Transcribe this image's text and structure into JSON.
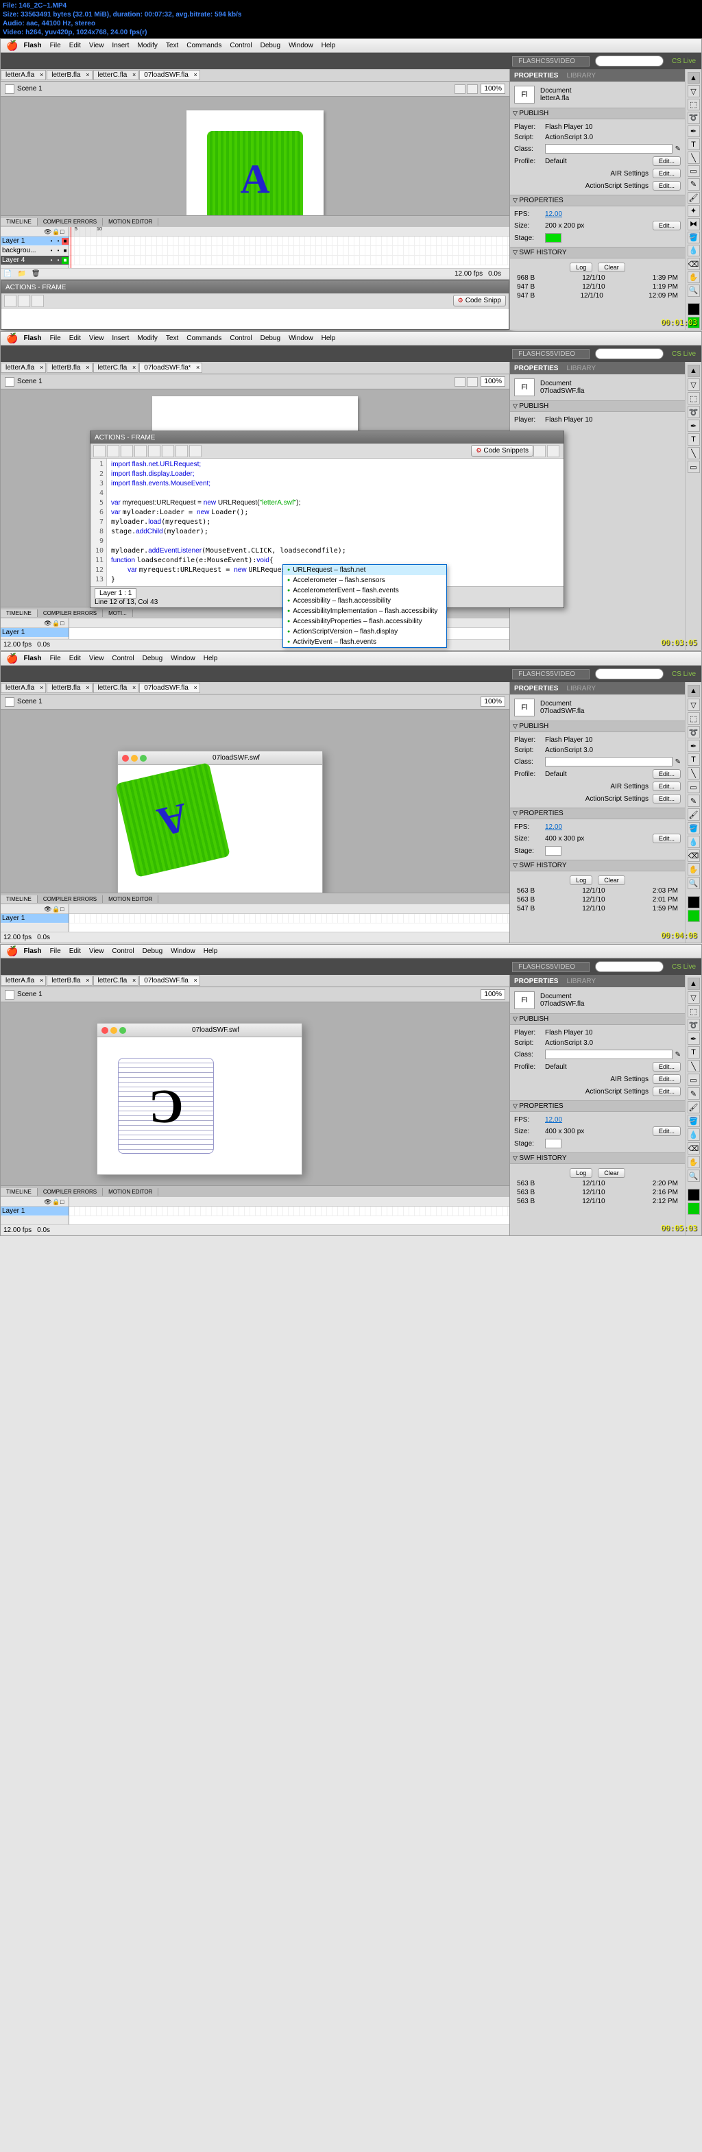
{
  "info": {
    "file": "File: 146_2C~1.MP4",
    "size": "Size: 33563491 bytes (32.01 MiB), duration: 00:07:32, avg.bitrate: 594 kb/s",
    "audio": "Audio: aac, 44100 Hz, stereo",
    "video": "Video: h264, yuv420p, 1024x768, 24.00 fps(r)"
  },
  "menu": {
    "app": "Flash",
    "items": [
      "File",
      "Edit",
      "View",
      "Insert",
      "Modify",
      "Text",
      "Commands",
      "Control",
      "Debug",
      "Window",
      "Help"
    ],
    "items_swf": [
      "File",
      "Edit",
      "View",
      "Control",
      "Debug",
      "Window",
      "Help"
    ]
  },
  "workspace_name": "FLASHCS5VIDEO",
  "cslive": "CS Live",
  "tabs": [
    "letterA.fla",
    "letterB.fla",
    "letterC.fla",
    "07loadSWF.fla"
  ],
  "scene": "Scene 1",
  "zoom": "100%",
  "timeline": {
    "tabs": [
      "TIMELINE",
      "COMPILER ERRORS",
      "MOTION EDITOR"
    ],
    "layers_s1": [
      "Layer 1",
      "backgrou...",
      "Layer 4"
    ],
    "layers_s2": [
      "Layer 1"
    ],
    "footer_fps": "12.00 fps",
    "footer_time": "0.0s"
  },
  "props": {
    "tabs": [
      "PROPERTIES",
      "LIBRARY"
    ],
    "doc_label": "Document",
    "doc_icon": "Fl",
    "publish": "PUBLISH",
    "properties": "PROPERTIES",
    "swf_history": "SWF HISTORY",
    "player_label": "Player:",
    "script_label": "Script:",
    "class_label": "Class:",
    "profile_label": "Profile:",
    "fps_label": "FPS:",
    "size_label": "Size:",
    "stage_label": "Stage:",
    "player": "Flash Player 10",
    "script": "ActionScript 3.0",
    "profile": "Default",
    "air_label": "AIR Settings",
    "as_label": "ActionScript Settings",
    "edit_btn": "Edit...",
    "log_btn": "Log",
    "clear_btn": "Clear",
    "s1": {
      "doc_name": "letterA.fla",
      "fps": "12.00",
      "size": "200 x 200 px",
      "history": [
        {
          "size": "968 B",
          "date": "12/1/10",
          "time": "1:39 PM"
        },
        {
          "size": "947 B",
          "date": "12/1/10",
          "time": "1:19 PM"
        },
        {
          "size": "947 B",
          "date": "12/1/10",
          "time": "12:09 PM"
        }
      ]
    },
    "s2": {
      "doc_name": "07loadSWF.fla",
      "fps": "12.00",
      "size": "400 x 300 px",
      "history": [
        {
          "size": "563 B",
          "date": "12/1/10",
          "time": "2:03 PM"
        },
        {
          "size": "563 B",
          "date": "12/1/10",
          "time": "2:01 PM"
        },
        {
          "size": "547 B",
          "date": "12/1/10",
          "time": "1:59 PM"
        }
      ]
    },
    "s4": {
      "history": [
        {
          "size": "563 B",
          "date": "12/1/10",
          "time": "2:20 PM"
        },
        {
          "size": "563 B",
          "date": "12/1/10",
          "time": "2:16 PM"
        },
        {
          "size": "563 B",
          "date": "12/1/10",
          "time": "2:12 PM"
        }
      ]
    }
  },
  "actions": {
    "title": "ACTIONS - FRAME",
    "snippets": "Code Snippets",
    "lines": [
      "1",
      "2",
      "3",
      "4",
      "5",
      "6",
      "7",
      "8",
      "9",
      "10",
      "11",
      "12",
      "13"
    ],
    "code_l1": "import flash.net.URLRequest;",
    "code_l2": "import flash.display.Loader;",
    "code_l3": "import flash.events.MouseEvent;",
    "code_l5a": "var ",
    "code_l5b": "myrequest",
    "code_l5c": ":URLRequest = ",
    "code_l5d": "new ",
    "code_l5e": "URLRequest(",
    "code_l5f": "\"letterA.swf\"",
    "code_l5g": ");",
    "code_l6": "var myloader:Loader = new Loader();",
    "code_l7": "myloader.load(myrequest);",
    "code_l8": "stage.addChild(myloader);",
    "code_l10": "myloader.addEventListener(MouseEvent.CLICK, loadsecondfile);",
    "code_l11": "function loadsecondfile(e:MouseEvent):void{",
    "code_l12": "    var myrequest:URLRequest = new URLRequest",
    "code_l13": "}",
    "footer_layer": "Layer 1 : 1",
    "footer_pos": "Line 12 of 13, Col 43",
    "autocomplete": [
      "URLRequest – flash.net",
      "Accelerometer – flash.sensors",
      "AccelerometerEvent – flash.events",
      "Accessibility – flash.accessibility",
      "AccessibilityImplementation – flash.accessibility",
      "AccessibilityProperties – flash.accessibility",
      "ActionScriptVersion – flash.display",
      "ActivityEvent – flash.events"
    ]
  },
  "swf": {
    "title": "07loadSWF.swf"
  },
  "timecodes": [
    "00:01:03",
    "00:03:05",
    "00:04:08",
    "00:05:03"
  ]
}
